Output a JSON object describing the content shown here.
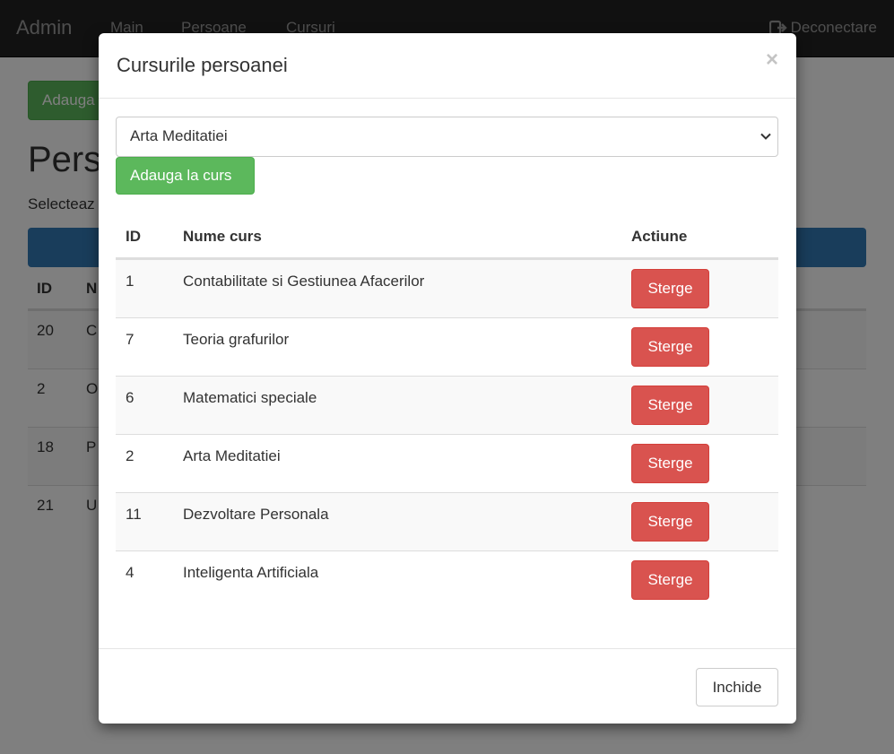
{
  "navbar": {
    "brand": "Admin",
    "links": [
      "Main",
      "Persoane",
      "Cursuri"
    ],
    "logout_label": "Deconectare",
    "logout_icon": "logout-icon"
  },
  "page": {
    "add_button": "Adauga",
    "title": "Pers",
    "subtitle": "Selecteaz",
    "table_headers": [
      "ID",
      "N"
    ],
    "rows": [
      {
        "id": "20",
        "name": "C"
      },
      {
        "id": "2",
        "name": "O"
      },
      {
        "id": "18",
        "name": "P"
      },
      {
        "id": "21",
        "name": "U"
      }
    ]
  },
  "modal": {
    "title": "Cursurile persoanei",
    "close_symbol": "×",
    "select_value": "Arta Meditatiei",
    "add_button": "Adauga la curs",
    "headers": {
      "id": "ID",
      "name": "Nume curs",
      "action": "Actiune"
    },
    "rows": [
      {
        "id": "1",
        "name": "Contabilitate si Gestiunea Afacerilor",
        "action": "Sterge"
      },
      {
        "id": "7",
        "name": "Teoria grafurilor",
        "action": "Sterge"
      },
      {
        "id": "6",
        "name": "Matematici speciale",
        "action": "Sterge"
      },
      {
        "id": "2",
        "name": "Arta Meditatiei",
        "action": "Sterge"
      },
      {
        "id": "11",
        "name": "Dezvoltare Personala",
        "action": "Sterge"
      },
      {
        "id": "4",
        "name": "Inteligenta Artificiala",
        "action": "Sterge"
      }
    ],
    "close_button": "Inchide"
  },
  "colors": {
    "navbar": "#222222",
    "success": "#5cb85c",
    "danger": "#d9534f",
    "primary": "#337ab7"
  }
}
